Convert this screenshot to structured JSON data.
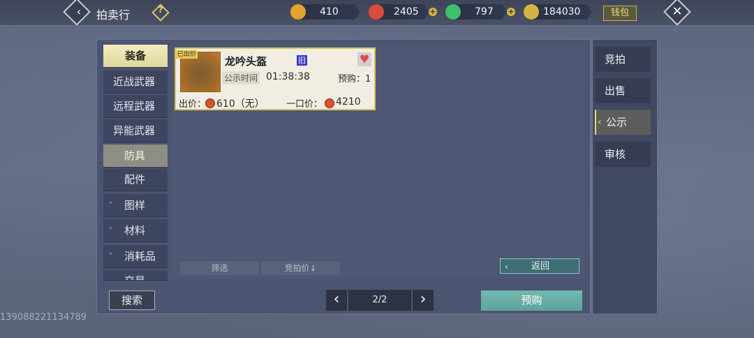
{
  "header": {
    "title": "拍卖行",
    "help_icon": "?",
    "currencies": [
      {
        "name": "gold-ingot",
        "value": "410",
        "color": "#e3a42c"
      },
      {
        "name": "red-gem",
        "value": "2405",
        "color": "#d94c3a"
      },
      {
        "name": "jade",
        "value": "797",
        "color": "#3fbf6c"
      },
      {
        "name": "gold-leaf",
        "value": "184030",
        "color": "#d8b142"
      }
    ],
    "plus": "+",
    "wallet_label": "钱包",
    "back_glyph": "‹",
    "close_glyph": "✕"
  },
  "categories": [
    {
      "label": "装备",
      "kind": "top",
      "active": true
    },
    {
      "label": "近战武器",
      "kind": "sub"
    },
    {
      "label": "远程武器",
      "kind": "sub"
    },
    {
      "label": "异能武器",
      "kind": "sub"
    },
    {
      "label": "防具",
      "kind": "sub",
      "active": true
    },
    {
      "label": "配件",
      "kind": "sub"
    },
    {
      "label": "图样",
      "kind": "group"
    },
    {
      "label": "材料",
      "kind": "group"
    },
    {
      "label": "消耗品",
      "kind": "group"
    },
    {
      "label": "交易",
      "kind": "group"
    }
  ],
  "listing": {
    "badge": "已出价",
    "name": "龙吟头盔",
    "tag": "旧",
    "time_label": "公示时间",
    "time_value": "01:38:38",
    "preorder_label": "预购：1",
    "bid_label": "出价：",
    "bid_value": "610（无）",
    "buyout_label": "一口价：",
    "buyout_value": "4210"
  },
  "filters": {
    "filter_label": "筛选",
    "sort_label": "竞拍价↓"
  },
  "return_label": "返回",
  "tabs": [
    {
      "label": "竞拍"
    },
    {
      "label": "出售"
    },
    {
      "label": "公示",
      "active": true
    },
    {
      "label": "审核"
    }
  ],
  "bottom": {
    "search_label": "搜索",
    "prev_glyph": "‹",
    "next_glyph": "›",
    "page_indicator": "2/2",
    "preorder_label": "预购"
  },
  "uid": "13908822113478​9"
}
